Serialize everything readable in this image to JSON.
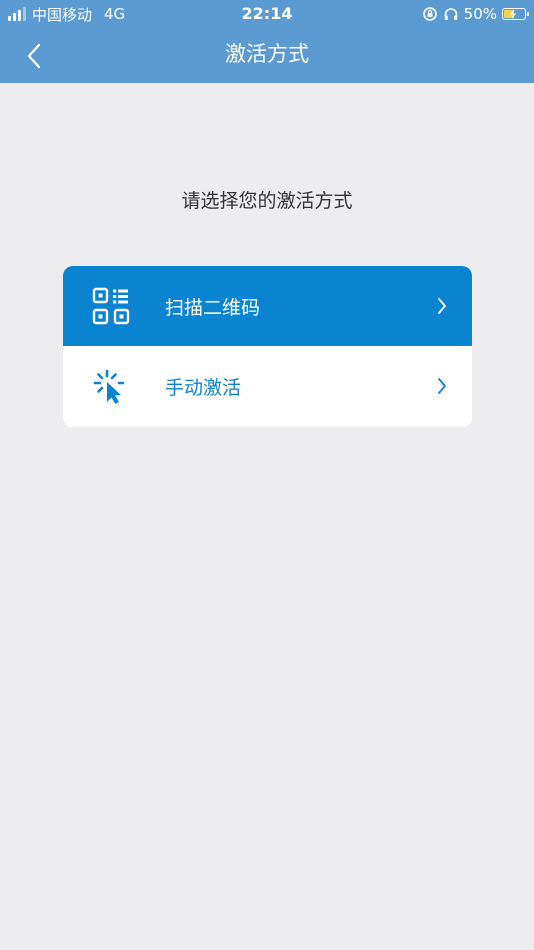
{
  "status_bar": {
    "carrier": "中国移动",
    "network": "4G",
    "time": "22:14",
    "battery": "50%"
  },
  "nav": {
    "title": "激活方式"
  },
  "prompt": "请选择您的激活方式",
  "options": [
    {
      "label": "扫描二维码",
      "icon": "qr-code-icon",
      "selected": true
    },
    {
      "label": "手动激活",
      "icon": "click-cursor-icon",
      "selected": false
    }
  ],
  "colors": {
    "header": "#5b9bd1",
    "accent": "#0a84d0",
    "background": "#ededf0"
  }
}
